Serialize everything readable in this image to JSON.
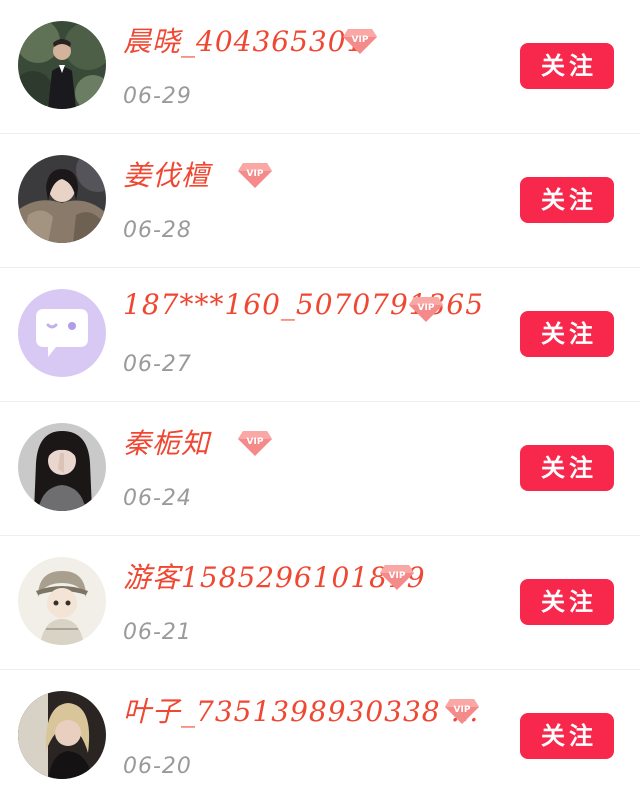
{
  "follow_list": {
    "items": [
      {
        "username": "晨晓_404365301",
        "vip_label": "VIP",
        "date": "06-29",
        "follow_label": "关注",
        "avatar": "photo-man-in-suit"
      },
      {
        "username": "姜伐檀",
        "vip_label": "VIP",
        "date": "06-28",
        "follow_label": "关注",
        "avatar": "photo-woman-fur-coat"
      },
      {
        "username": "187***160_5070791365",
        "vip_label": "VIP",
        "date": "06-27",
        "follow_label": "关注",
        "avatar": "default-chat-bubble-avatar"
      },
      {
        "username": "秦栀知",
        "vip_label": "VIP",
        "date": "06-24",
        "follow_label": "关注",
        "avatar": "photo-woman-long-hair"
      },
      {
        "username": "游客1585296101819",
        "vip_label": "VIP",
        "date": "06-21",
        "follow_label": "关注",
        "avatar": "illustration-girl-sketch"
      },
      {
        "username": "叶子_7351398930338 …",
        "vip_label": "VIP",
        "date": "06-20",
        "follow_label": "关注",
        "avatar": "photo-woman-blonde"
      }
    ]
  },
  "colors": {
    "username": "#ef4732",
    "date": "#9a9a9a",
    "follow_button": "#f7284b",
    "vip_badge": "#f58a8a",
    "divider": "#eeeeee"
  }
}
